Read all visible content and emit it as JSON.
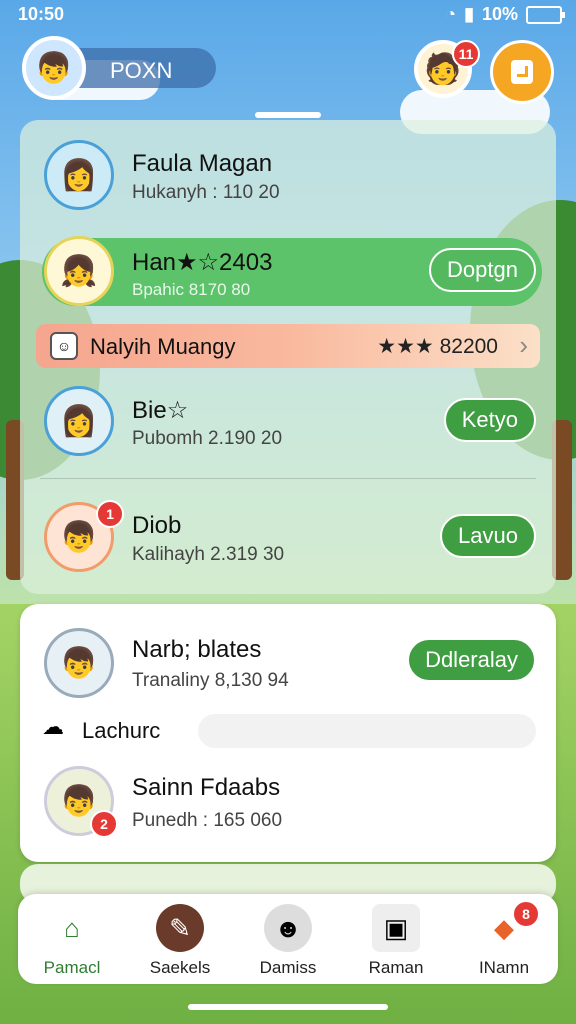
{
  "status": {
    "time": "10:50",
    "battery": "10%"
  },
  "header": {
    "username": "POXN",
    "friend_badge": "11"
  },
  "list": [
    {
      "name": "Faula Magan",
      "sub": "Hukanyh : 110 20"
    },
    {
      "name": "Han★☆2403",
      "sub": "Bpahic 8170 80",
      "button": "Doptgn"
    },
    {
      "name": "Bie☆",
      "sub": "Pubomh 2.190 20",
      "button": "Ketyo"
    },
    {
      "name": "Diob",
      "sub": "Kalihayh 2.319 30",
      "button": "Lavuo",
      "badge": "1"
    }
  ],
  "banner": {
    "label": "Nalyih Muangy",
    "score": "★★★ 82200"
  },
  "white_panel": {
    "rows": [
      {
        "name": "Narb; blates",
        "sub": "Tranaliny 8,130 94",
        "button": "Ddleralay"
      },
      {
        "name": "Sainn Fdaabs",
        "sub": "Punedh : 165 060",
        "badge": "2"
      }
    ],
    "section_label": "Lachurc"
  },
  "nav": [
    {
      "label": "Pamacl",
      "icon": "home-icon",
      "active": true
    },
    {
      "label": "Saekels",
      "icon": "chat-icon"
    },
    {
      "label": "Damiss",
      "icon": "cat-icon"
    },
    {
      "label": "Raman",
      "icon": "box-icon"
    },
    {
      "label": "INamn",
      "icon": "dog-icon",
      "badge": "8"
    }
  ]
}
